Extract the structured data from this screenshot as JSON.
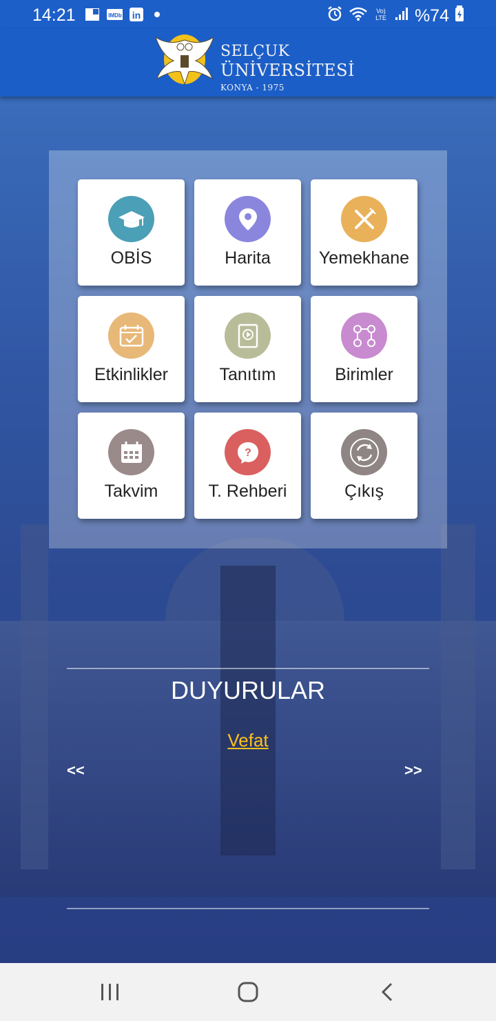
{
  "status_bar": {
    "time": "14:21",
    "battery": "%74",
    "icons_left": [
      "image-icon",
      "imdb-icon",
      "linkedin-icon",
      "dot-icon"
    ],
    "icons_right": [
      "alarm-icon",
      "wifi-icon",
      "volte-icon",
      "signal-icon",
      "battery-icon"
    ]
  },
  "header": {
    "logo_line1": "SELÇUK",
    "logo_line2": "ÜNİVERSİTESİ",
    "logo_line3": "KONYA - 1975",
    "color": "#1b5ec8"
  },
  "menu": {
    "tiles": [
      {
        "label": "OBİS",
        "icon": "graduation-cap-icon",
        "color": "#4b9fb6"
      },
      {
        "label": "Harita",
        "icon": "location-pin-icon",
        "color": "#8a86de"
      },
      {
        "label": "Yemekhane",
        "icon": "fork-knife-icon",
        "color": "#e9b15a"
      },
      {
        "label": "Etkinlikler",
        "icon": "calendar-check-icon",
        "color": "#e8b878"
      },
      {
        "label": "Tanıtım",
        "icon": "video-book-icon",
        "color": "#b8bc98"
      },
      {
        "label": "Birimler",
        "icon": "network-icon",
        "color": "#c88bcf"
      },
      {
        "label": "Takvim",
        "icon": "calendar-icon",
        "color": "#9a8a8a"
      },
      {
        "label": "T. Rehberi",
        "icon": "help-chat-icon",
        "color": "#d9605f"
      },
      {
        "label": "Çıkış",
        "icon": "refresh-exit-icon",
        "color": "#8f8585"
      }
    ]
  },
  "announcements": {
    "title": "DUYURULAR",
    "item": "Vefat",
    "prev": "<<",
    "next": ">>"
  },
  "nav": {
    "buttons": [
      "recent-apps-icon",
      "home-icon",
      "back-icon"
    ]
  }
}
